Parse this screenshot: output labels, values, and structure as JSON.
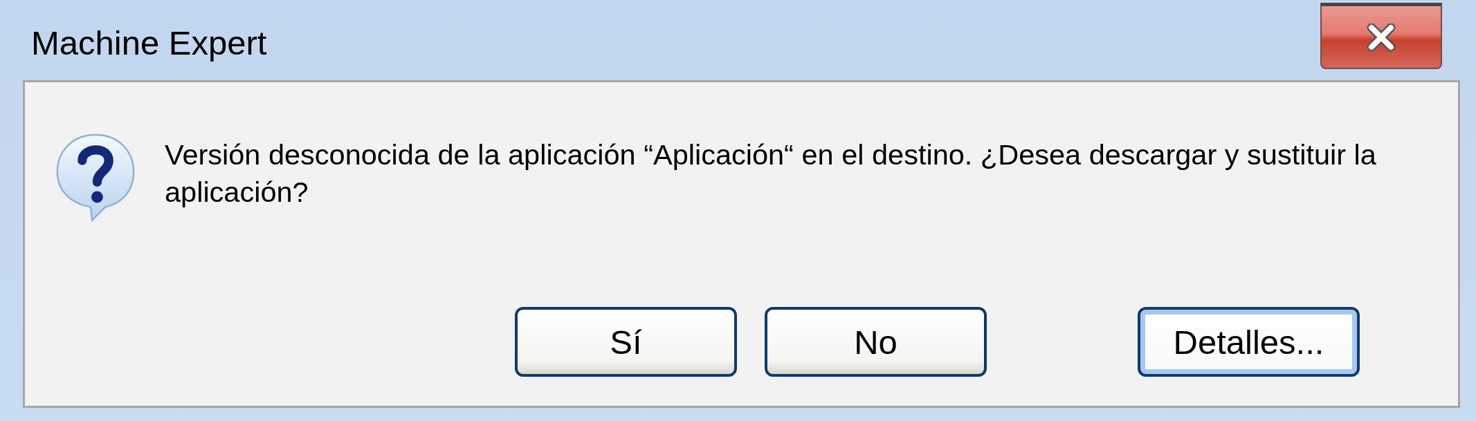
{
  "window": {
    "title": "Machine Expert"
  },
  "dialog": {
    "message": "Versión desconocida de la aplicación “Aplicación“ en el destino. ¿Desea descargar y sustituir la aplicación?"
  },
  "buttons": [
    {
      "label": "Sí",
      "focused": false
    },
    {
      "label": "No",
      "focused": false
    },
    {
      "label": "Detalles...",
      "focused": true
    }
  ]
}
